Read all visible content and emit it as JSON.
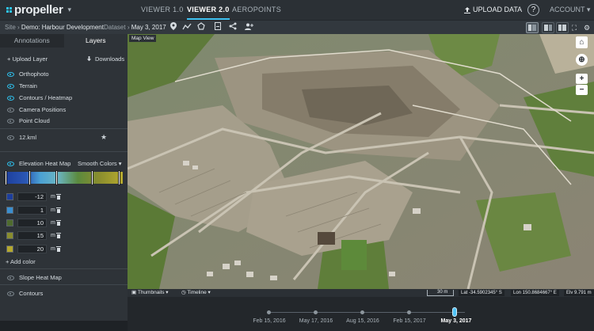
{
  "brand": {
    "name": "propeller"
  },
  "nav": {
    "tabs": [
      {
        "label": "VIEWER 1.0"
      },
      {
        "label": "VIEWER 2.0"
      },
      {
        "label": "AEROPOINTS"
      }
    ],
    "upload_label": "UPLOAD DATA",
    "help_label": "?",
    "account_label": "ACCOUNT"
  },
  "breadcrumb": {
    "site_label": "Site",
    "site_value": "Demo: Harbour Development",
    "dataset_label": "Dataset",
    "dataset_value": "May 3, 2017"
  },
  "sidebar": {
    "tabs": [
      {
        "label": "Annotations"
      },
      {
        "label": "Layers"
      }
    ],
    "upload_layer": "+ Upload Layer",
    "downloads": "Downloads",
    "layers": [
      {
        "label": "Orthophoto",
        "visible": true
      },
      {
        "label": "Terrain",
        "visible": true
      },
      {
        "label": "Contours / Heatmap",
        "visible": true
      },
      {
        "label": "Camera Positions",
        "visible": false
      },
      {
        "label": "Point Cloud",
        "visible": false
      }
    ],
    "kml_layer": "12.kml",
    "heatmap": {
      "label": "Elevation Heat Map",
      "mode": "Smooth Colors",
      "stops": [
        {
          "value": "-12",
          "unit": "m",
          "color": "#1d3e9c"
        },
        {
          "value": "1",
          "unit": "m",
          "color": "#3a8fd0"
        },
        {
          "value": "10",
          "unit": "m",
          "color": "#4f6b2e"
        },
        {
          "value": "15",
          "unit": "m",
          "color": "#8a8d2e"
        },
        {
          "value": "20",
          "unit": "m",
          "color": "#b5a92e"
        }
      ],
      "add_color": "+ Add color"
    },
    "slope_heat_map": "Slope Heat Map",
    "contours": "Contours"
  },
  "map": {
    "view_label": "Map View",
    "thumbnails_label": "Thumbnails",
    "timeline_label": "Timeline",
    "scale_label": "30 m",
    "lat": "Lat -34.5902345° S",
    "lon": "Lon 150.8684667° E",
    "elevation": "Elv 9.791 m"
  },
  "timeline": {
    "dates": [
      {
        "label": "Feb 15, 2016",
        "selected": false
      },
      {
        "label": "May 17, 2016",
        "selected": false
      },
      {
        "label": "Aug 15, 2016",
        "selected": false
      },
      {
        "label": "Feb 15, 2017",
        "selected": false
      },
      {
        "label": "May 3, 2017",
        "selected": true
      }
    ]
  },
  "colors": {
    "accent": "#2ec4f1",
    "topbar": "#2b3035",
    "sidebar": "#2e3338"
  }
}
